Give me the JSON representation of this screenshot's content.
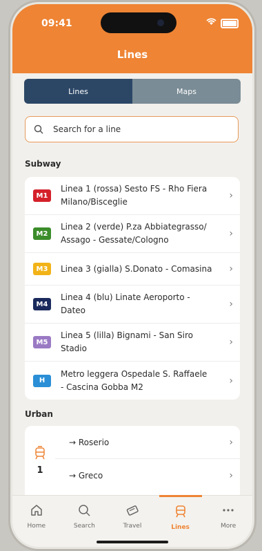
{
  "status": {
    "time": "09:41"
  },
  "header": {
    "title": "Lines"
  },
  "segments": [
    {
      "label": "Lines",
      "active": true
    },
    {
      "label": "Maps",
      "active": false
    }
  ],
  "search": {
    "placeholder": "Search for a line"
  },
  "subway": {
    "title": "Subway",
    "lines": [
      {
        "badge": "M1",
        "color": "#d4202a",
        "line1": "Linea 1 (rossa) Sesto FS - Rho Fiera",
        "line2": "Milano/Bisceglie"
      },
      {
        "badge": "M2",
        "color": "#3b8c2a",
        "line1": "Linea 2 (verde) P.za Abbiategrasso/",
        "line2": "Assago - Gessate/Cologno"
      },
      {
        "badge": "M3",
        "color": "#f2b318",
        "line1": "Linea 3 (gialla) S.Donato - Comasina",
        "line2": ""
      },
      {
        "badge": "M4",
        "color": "#1a2a5c",
        "line1": "Linea 4 (blu) Linate Aeroporto -",
        "line2": "Dateo"
      },
      {
        "badge": "M5",
        "color": "#9b7ac4",
        "line1": "Linea 5 (lilla) Bignami - San Siro",
        "line2": "Stadio"
      },
      {
        "badge": "H",
        "color": "#2a8fd6",
        "line1": "Metro leggera Ospedale S. Raffaele",
        "line2": "- Cascina Gobba M2"
      }
    ]
  },
  "urban": {
    "title": "Urban",
    "line_number": "1",
    "routes": [
      "→ Roserio",
      "→ Greco"
    ]
  },
  "tabs": [
    {
      "label": "Home",
      "icon": "home-icon",
      "active": false
    },
    {
      "label": "Search",
      "icon": "search-icon",
      "active": false
    },
    {
      "label": "Travel",
      "icon": "ticket-icon",
      "active": false
    },
    {
      "label": "Lines",
      "icon": "tram-icon",
      "active": true
    },
    {
      "label": "More",
      "icon": "more-icon",
      "active": false
    }
  ],
  "colors": {
    "accent": "#ee8434",
    "segment_active": "#2c4766",
    "segment_inactive": "#7a8c96"
  }
}
